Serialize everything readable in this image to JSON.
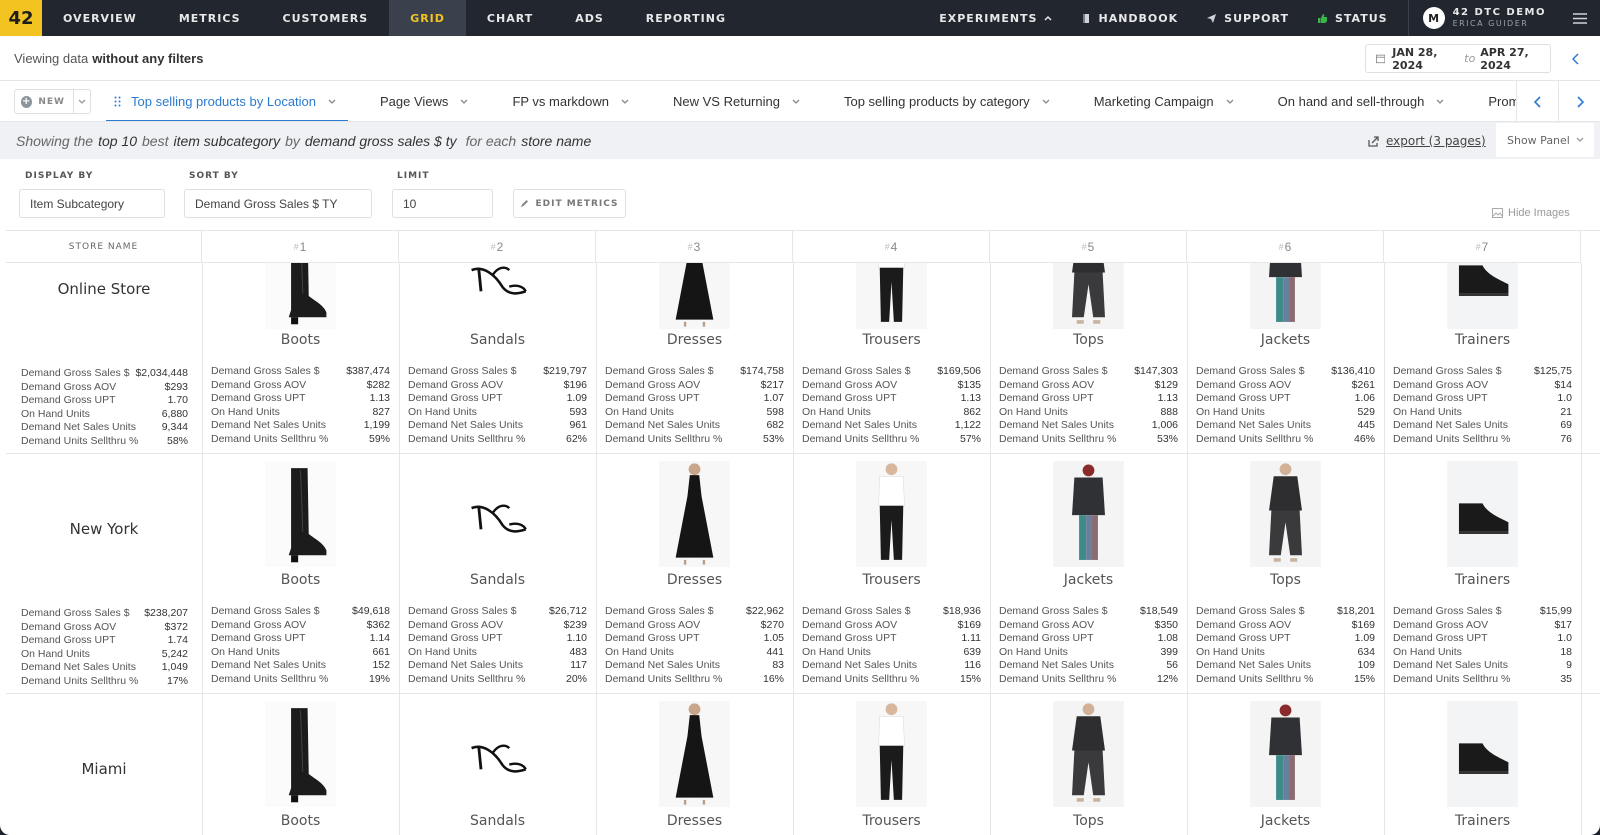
{
  "nav": {
    "logo": "42",
    "items": [
      "OVERVIEW",
      "METRICS",
      "CUSTOMERS",
      "GRID",
      "CHART",
      "ADS",
      "REPORTING"
    ],
    "active": "GRID",
    "right": {
      "experiments": "EXPERIMENTS",
      "handbook": "HANDBOOK",
      "support": "SUPPORT",
      "status": "STATUS"
    },
    "account": {
      "initials": "M",
      "name": "42 DTC DEMO",
      "sub": "ERICA GUIDER"
    }
  },
  "filterbar": {
    "prefix": "Viewing data",
    "emphasis": "without any filters"
  },
  "daterange": {
    "from": "JAN 28, 2024",
    "to_label": "to",
    "to": "APR 27, 2024"
  },
  "tabs": {
    "new_label": "NEW",
    "items": [
      {
        "label": "Top selling products by Location",
        "active": true
      },
      {
        "label": "Page Views"
      },
      {
        "label": "FP vs markdown"
      },
      {
        "label": "New VS Returning"
      },
      {
        "label": "Top selling products by category"
      },
      {
        "label": "Marketing Campaign"
      },
      {
        "label": "On hand and sell-through"
      },
      {
        "label": "Promo"
      }
    ]
  },
  "summary": {
    "showing": "Showing the",
    "top": "top 10",
    "best": "best",
    "dim": "item subcategory",
    "by": "by",
    "metric": "demand gross sales $ ty",
    "for_each": "for each",
    "group": "store name",
    "export": "export (3 pages)",
    "show_panel": "Show Panel"
  },
  "controls": {
    "display_by_label": "DISPLAY BY",
    "display_by": "Item Subcategory",
    "sort_by_label": "SORT BY",
    "sort_by": "Demand Gross Sales $ TY",
    "limit_label": "LIMIT",
    "limit": "10",
    "edit_metrics": "EDIT METRICS",
    "hide_images": "Hide Images"
  },
  "grid": {
    "store_header": "STORE NAME",
    "rank_headers": [
      "1",
      "2",
      "3",
      "4",
      "5",
      "6",
      "7"
    ],
    "metric_labels": [
      "Demand Gross Sales $",
      "Demand Gross AOV",
      "Demand Gross UPT",
      "On Hand Units",
      "Demand Net Sales Units",
      "Demand Units Sellthru %"
    ],
    "rows": [
      {
        "store": "Online Store",
        "totals": [
          "$2,034,448",
          "$293",
          "1.70",
          "6,880",
          "9,344",
          "58%"
        ],
        "cells": [
          {
            "cat": "Boots",
            "icon": "boots",
            "values": [
              "$387,474",
              "$282",
              "1.13",
              "827",
              "1,199",
              "59%"
            ]
          },
          {
            "cat": "Sandals",
            "icon": "sandals",
            "values": [
              "$219,797",
              "$196",
              "1.09",
              "593",
              "961",
              "62%"
            ]
          },
          {
            "cat": "Dresses",
            "icon": "dress",
            "values": [
              "$174,758",
              "$217",
              "1.07",
              "598",
              "682",
              "53%"
            ]
          },
          {
            "cat": "Trousers",
            "icon": "trousers",
            "values": [
              "$169,506",
              "$135",
              "1.13",
              "862",
              "1,122",
              "57%"
            ]
          },
          {
            "cat": "Tops",
            "icon": "tops",
            "values": [
              "$147,303",
              "$129",
              "1.13",
              "888",
              "1,006",
              "53%"
            ]
          },
          {
            "cat": "Jackets",
            "icon": "jacket",
            "values": [
              "$136,410",
              "$261",
              "1.06",
              "529",
              "445",
              "46%"
            ]
          },
          {
            "cat": "Trainers",
            "icon": "trainers",
            "values": [
              "$125,75",
              "$14",
              "1.0",
              "21",
              "69",
              "76"
            ]
          }
        ]
      },
      {
        "store": "New York",
        "totals": [
          "$238,207",
          "$372",
          "1.74",
          "5,242",
          "1,049",
          "17%"
        ],
        "cells": [
          {
            "cat": "Boots",
            "icon": "boots",
            "values": [
              "$49,618",
              "$362",
              "1.14",
              "661",
              "152",
              "19%"
            ]
          },
          {
            "cat": "Sandals",
            "icon": "sandals",
            "values": [
              "$26,712",
              "$239",
              "1.10",
              "483",
              "117",
              "20%"
            ]
          },
          {
            "cat": "Dresses",
            "icon": "dress",
            "values": [
              "$22,962",
              "$270",
              "1.05",
              "441",
              "83",
              "16%"
            ]
          },
          {
            "cat": "Trousers",
            "icon": "trousers",
            "values": [
              "$18,936",
              "$169",
              "1.11",
              "639",
              "116",
              "15%"
            ]
          },
          {
            "cat": "Jackets",
            "icon": "jacket",
            "values": [
              "$18,549",
              "$350",
              "1.08",
              "399",
              "56",
              "12%"
            ]
          },
          {
            "cat": "Tops",
            "icon": "tops",
            "values": [
              "$18,201",
              "$169",
              "1.09",
              "634",
              "109",
              "15%"
            ]
          },
          {
            "cat": "Trainers",
            "icon": "trainers",
            "values": [
              "$15,99",
              "$17",
              "1.0",
              "18",
              "9",
              "35"
            ]
          }
        ]
      },
      {
        "store": "Miami",
        "totals": [],
        "cells": [
          {
            "cat": "Boots",
            "icon": "boots",
            "values": []
          },
          {
            "cat": "Sandals",
            "icon": "sandals",
            "values": []
          },
          {
            "cat": "Dresses",
            "icon": "dress",
            "values": []
          },
          {
            "cat": "Trousers",
            "icon": "trousers",
            "values": []
          },
          {
            "cat": "Tops",
            "icon": "tops",
            "values": []
          },
          {
            "cat": "Jackets",
            "icon": "jacket",
            "values": []
          },
          {
            "cat": "Trainers",
            "icon": "trainers",
            "values": []
          }
        ]
      }
    ]
  },
  "colors": {
    "accent": "#f3c322",
    "nav_bg": "#22272f",
    "link": "#2b7bd1",
    "panel_bg": "#eff1f4"
  }
}
